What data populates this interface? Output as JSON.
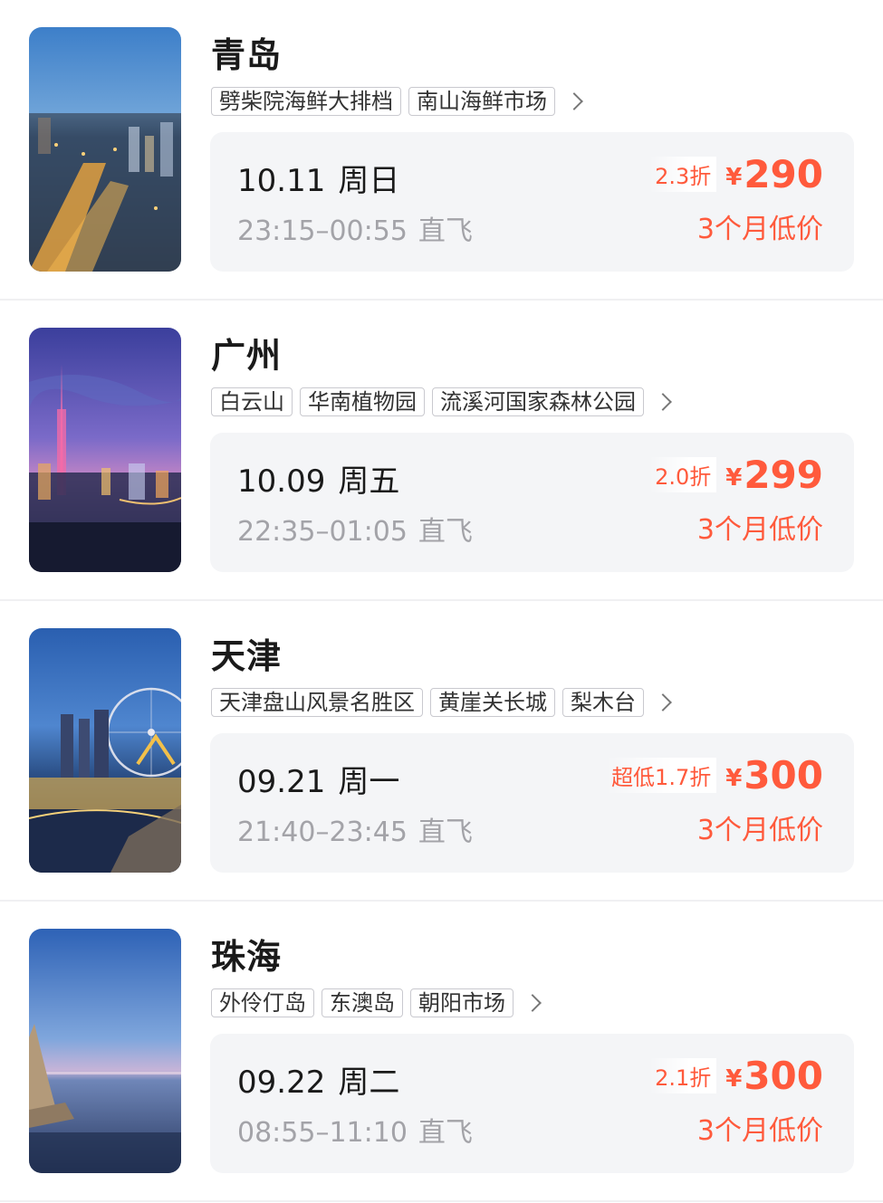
{
  "destinations": [
    {
      "city": "青岛",
      "tags": [
        "劈柴院海鲜大排档",
        "南山海鲜市场"
      ],
      "date": "10.11",
      "weekday": "周日",
      "time": "23:15–00:55",
      "flight_type": "直飞",
      "discount": "2.3折",
      "currency": "¥",
      "price": "290",
      "price_note": "3个月低价"
    },
    {
      "city": "广州",
      "tags": [
        "白云山",
        "华南植物园",
        "流溪河国家森林公园"
      ],
      "date": "10.09",
      "weekday": "周五",
      "time": "22:35–01:05",
      "flight_type": "直飞",
      "discount": "2.0折",
      "currency": "¥",
      "price": "299",
      "price_note": "3个月低价"
    },
    {
      "city": "天津",
      "tags": [
        "天津盘山风景名胜区",
        "黄崖关长城",
        "梨木台"
      ],
      "date": "09.21",
      "weekday": "周一",
      "time": "21:40–23:45",
      "flight_type": "直飞",
      "discount": "超低1.7折",
      "currency": "¥",
      "price": "300",
      "price_note": "3个月低价"
    },
    {
      "city": "珠海",
      "tags": [
        "外伶仃岛",
        "东澳岛",
        "朝阳市场"
      ],
      "date": "09.22",
      "weekday": "周二",
      "time": "08:55–11:10",
      "flight_type": "直飞",
      "discount": "2.1折",
      "currency": "¥",
      "price": "300",
      "price_note": "3个月低价"
    }
  ],
  "colors": {
    "accent": "#ff5a3c",
    "card_bg": "#f4f5f7",
    "muted": "#a3a3a8"
  }
}
